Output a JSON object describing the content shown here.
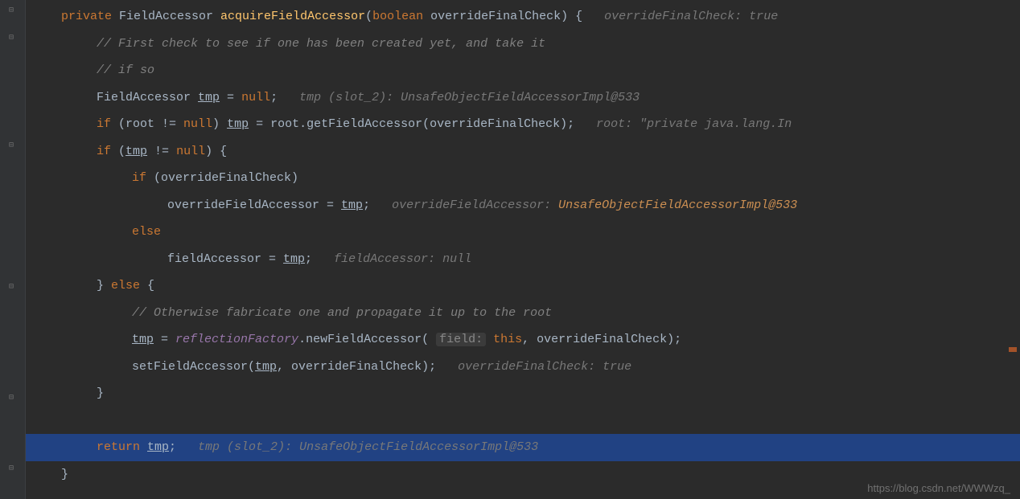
{
  "code": {
    "l1": {
      "kw1": "private",
      "type": " FieldAccessor ",
      "method": "acquireFieldAccessor",
      "paren1": "(",
      "kw2": "boolean",
      "param": " overrideFinalCheck) {   ",
      "hint": "overrideFinalCheck: true"
    },
    "l2": {
      "comment": "// First check to see if one has been created yet, and take it"
    },
    "l3": {
      "comment": "// if so"
    },
    "l4": {
      "text1": "FieldAccessor ",
      "var": "tmp",
      "text2": " = ",
      "nullkw": "null",
      "text3": ";   ",
      "hint": "tmp (slot_2): UnsafeObjectFieldAccessorImpl@533"
    },
    "l5": {
      "kw": "if ",
      "text1": "(root != ",
      "nullkw": "null",
      "text2": ") ",
      "var": "tmp",
      "text3": " = root.getFieldAccessor(overrideFinalCheck);   ",
      "hint": "root: \"private java.lang.In"
    },
    "l6": {
      "kw": "if ",
      "text1": "(",
      "var": "tmp",
      "text2": " != ",
      "nullkw": "null",
      "text3": ") {"
    },
    "l7": {
      "kw": "if ",
      "text": "(overrideFinalCheck)"
    },
    "l8": {
      "text1": "overrideFieldAccessor = ",
      "var": "tmp",
      "text2": ";   ",
      "hintlabel": "overrideFieldAccessor: ",
      "hintval": "UnsafeObjectFieldAccessorImpl@533"
    },
    "l9": {
      "kw": "else"
    },
    "l10": {
      "text1": "fieldAccessor = ",
      "var": "tmp",
      "text2": ";   ",
      "hint": "fieldAccessor: null"
    },
    "l11": {
      "text1": "} ",
      "kw": "else ",
      "text2": "{"
    },
    "l12": {
      "comment": "// Otherwise fabricate one and propagate it up to the root"
    },
    "l13": {
      "var": "tmp",
      "text1": " = ",
      "static": "reflectionFactory",
      "text2": ".newFieldAccessor( ",
      "paramhint": "field:",
      "text3": " ",
      "kw": "this",
      "text4": ", overrideFinalCheck);"
    },
    "l14": {
      "text1": "setFieldAccessor(",
      "var": "tmp",
      "text2": ", overrideFinalCheck);   ",
      "hint": "overrideFinalCheck: true"
    },
    "l15": {
      "text": "}"
    },
    "l16": {
      "text": ""
    },
    "l17": {
      "kw": "return ",
      "var": "tmp",
      "text": ";   ",
      "hint": "tmp (slot_2): UnsafeObjectFieldAccessorImpl@533"
    },
    "l18": {
      "text": "}"
    }
  },
  "watermark": "https://blog.csdn.net/WWWzq_"
}
